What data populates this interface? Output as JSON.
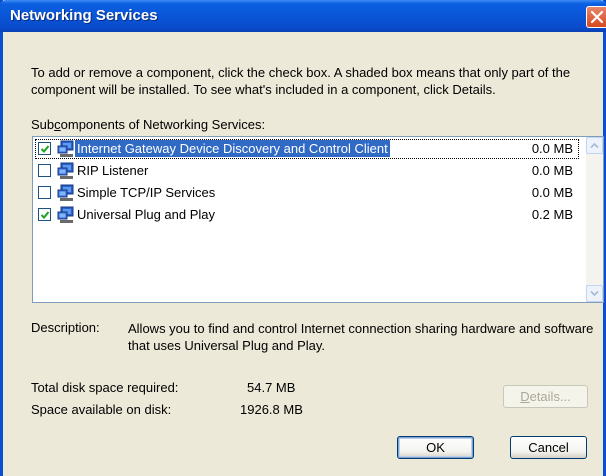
{
  "window": {
    "title": "Networking Services",
    "close_icon": "close-icon"
  },
  "intro_text": "To add or remove a component, click the check box. A shaded box means that only part of the component will be installed. To see what's included in a component, click Details.",
  "list": {
    "label_prefix": "Sub",
    "label_underlined": "c",
    "label_suffix": "omponents of Networking Services:",
    "items": [
      {
        "name": "Internet Gateway Device Discovery and Control Client",
        "size": "0.0 MB",
        "checked": true,
        "selected": true,
        "icon": "network-computer-icon"
      },
      {
        "name": "RIP Listener",
        "size": "0.0 MB",
        "checked": false,
        "selected": false,
        "icon": "network-computer-icon"
      },
      {
        "name": "Simple TCP/IP Services",
        "size": "0.0 MB",
        "checked": false,
        "selected": false,
        "icon": "network-computer-icon"
      },
      {
        "name": "Universal Plug and Play",
        "size": "0.2 MB",
        "checked": true,
        "selected": false,
        "icon": "network-computer-icon"
      }
    ]
  },
  "description": {
    "label": "Description:",
    "text": "Allows you to find and control Internet connection sharing hardware and software that uses Universal Plug and Play."
  },
  "disk": {
    "required_label": "Total disk space required:",
    "required_value": "54.7 MB",
    "available_label": "Space available on disk:",
    "available_value": "1926.8 MB"
  },
  "buttons": {
    "details_prefix": "",
    "details_underlined": "D",
    "details_suffix": "etails...",
    "ok": "OK",
    "cancel": "Cancel"
  },
  "colors": {
    "title_bar": "#0A55D8",
    "selection": "#316AC5",
    "dialog_bg": "#ECE9D8"
  }
}
